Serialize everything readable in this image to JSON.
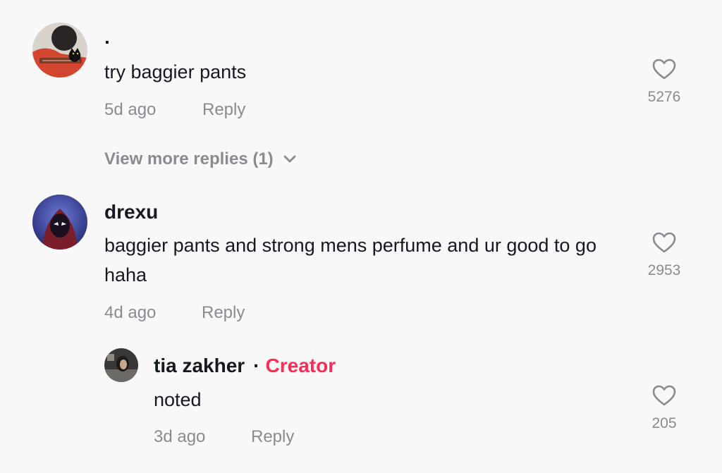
{
  "comments": [
    {
      "username": "·",
      "text": "try baggier pants",
      "time": "5d ago",
      "reply_label": "Reply",
      "likes": "5276",
      "avatar_icon": "black-cat-guitar-avatar",
      "view_more_label": "View more replies (1)"
    },
    {
      "username": "drexu",
      "text": "baggier pants and strong mens perfume and ur good to go haha",
      "time": "4d ago",
      "reply_label": "Reply",
      "likes": "2953",
      "avatar_icon": "spider-hero-avatar",
      "replies": [
        {
          "username": "tia zakher",
          "separator": "·",
          "badge": "Creator",
          "text": "noted",
          "time": "3d ago",
          "reply_label": "Reply",
          "likes": "205",
          "avatar_icon": "user-photo-avatar"
        }
      ]
    }
  ],
  "colors": {
    "background": "#f8f8f8",
    "text": "#161823",
    "muted": "#8a8b91",
    "creator": "#fe2c55"
  },
  "icons": {
    "like": "heart-outline-icon",
    "expand": "chevron-down-icon"
  }
}
